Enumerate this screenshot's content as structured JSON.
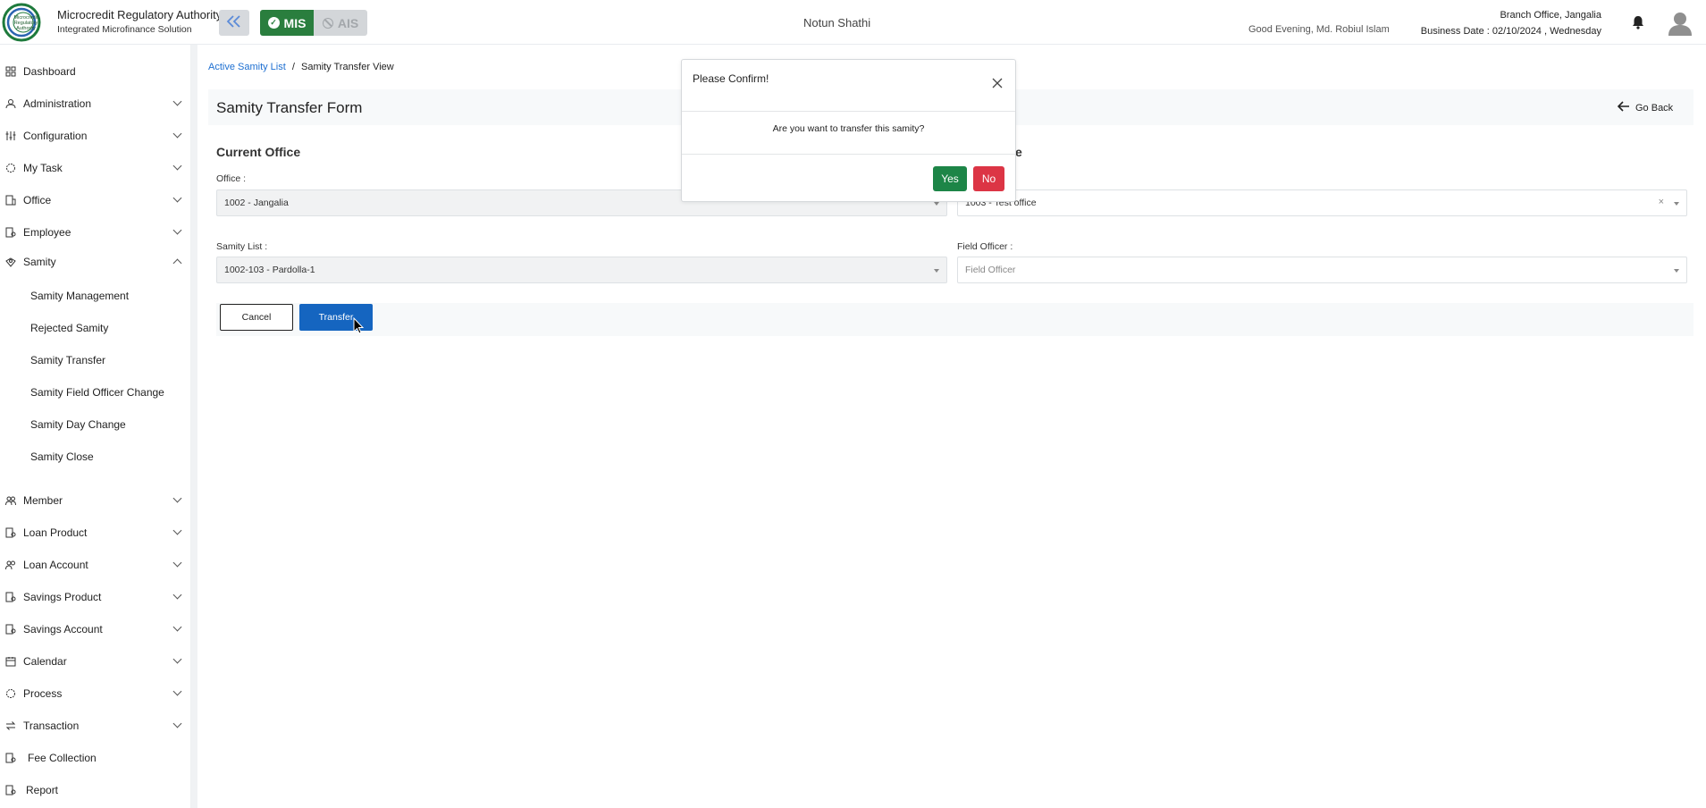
{
  "header": {
    "org_name": "Microcredit Regulatory Authority",
    "org_sub": "Integrated Microfinance Solution",
    "logo_text": "Microcredit Regulatory Authority",
    "mode_mis": "MIS",
    "mode_ais": "AIS",
    "app_name": "Notun Shathi",
    "greeting": "Good Evening, Md. Robiul Islam",
    "branch": "Branch Office, Jangalia",
    "business_date": "Business Date : 02/10/2024 , Wednesday"
  },
  "sidebar": {
    "items": [
      {
        "label": "Dashboard",
        "icon": "dashboard-icon",
        "caret": false
      },
      {
        "label": "Administration",
        "icon": "admin-icon",
        "caret": true
      },
      {
        "label": "Configuration",
        "icon": "sliders-icon",
        "caret": true
      },
      {
        "label": "My Task",
        "icon": "task-icon",
        "caret": true
      },
      {
        "label": "Office",
        "icon": "building-icon",
        "caret": true
      },
      {
        "label": "Employee",
        "icon": "employee-icon",
        "caret": true
      },
      {
        "label": "Samity",
        "icon": "samity-icon",
        "caret": true,
        "expanded": true
      },
      {
        "label": "Member",
        "icon": "member-icon",
        "caret": true
      },
      {
        "label": "Loan Product",
        "icon": "loan-product-icon",
        "caret": true
      },
      {
        "label": "Loan Account",
        "icon": "loan-account-icon",
        "caret": true
      },
      {
        "label": "Savings Product",
        "icon": "savings-product-icon",
        "caret": true
      },
      {
        "label": "Savings Account",
        "icon": "savings-account-icon",
        "caret": true
      },
      {
        "label": "Calendar",
        "icon": "calendar-icon",
        "caret": true
      },
      {
        "label": "Process",
        "icon": "process-icon",
        "caret": true
      },
      {
        "label": "Transaction",
        "icon": "transaction-icon",
        "caret": true
      },
      {
        "label": "Fee Collection",
        "icon": "fee-icon",
        "caret": false
      },
      {
        "label": "Report",
        "icon": "report-icon",
        "caret": false
      }
    ],
    "samity_sub": [
      "Samity Management",
      "Rejected Samity",
      "Samity Transfer",
      "Samity Field Officer Change",
      "Samity Day Change",
      "Samity Close"
    ]
  },
  "breadcrumb": {
    "link": "Active Samity List",
    "separator": "/",
    "current": "Samity Transfer View"
  },
  "page": {
    "title": "Samity Transfer Form",
    "go_back": "Go Back"
  },
  "form": {
    "current_office_title": "Current Office",
    "target_office_title_visible": "e",
    "office_label": "Office :",
    "office_value": "1002 - Jangalia",
    "target_office_value": "1003 - Test office",
    "samity_list_label": "Samity List :",
    "samity_list_value": "1002-103 - Pardolla-1",
    "field_officer_label": "Field Officer :",
    "field_officer_placeholder": "Field Officer",
    "cancel": "Cancel",
    "transfer": "Transfer"
  },
  "modal": {
    "title": "Please Confirm!",
    "message": "Are you want to transfer this samity?",
    "yes": "Yes",
    "no": "No"
  },
  "colors": {
    "accent_blue": "#1565c0",
    "mis_green": "#2a7e3e",
    "yes_green": "#1d8547",
    "no_red": "#dc3545",
    "link_blue": "#1d6fd1"
  }
}
